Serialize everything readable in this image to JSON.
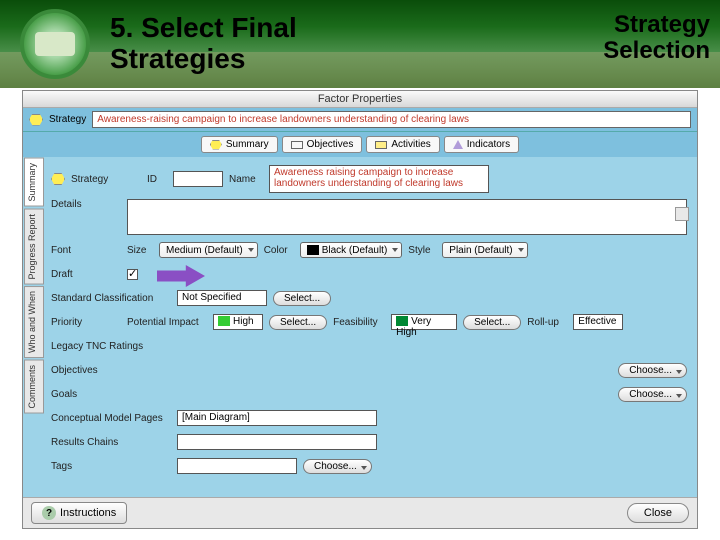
{
  "header": {
    "title_left": "5. Select Final\nStrategies",
    "title_right": "Strategy\nSelection"
  },
  "window": {
    "title": "Factor Properties",
    "strategy_label": "Strategy",
    "strategy_value": "Awareness-raising campaign to increase landowners understanding of clearing laws",
    "tabs": [
      "Summary",
      "Objectives",
      "Activities",
      "Indicators"
    ],
    "side_tabs": [
      "Summary",
      "Progress Report",
      "Who and When",
      "Comments"
    ]
  },
  "form": {
    "strategy_label": "Strategy",
    "id_label": "ID",
    "id_value": "",
    "name_label": "Name",
    "name_value": "Awareness raising campaign to increase landowners understanding of clearing laws",
    "details_label": "Details",
    "font_label": "Font",
    "size_label": "Size",
    "size_value": "Medium (Default)",
    "color_label": "Color",
    "color_value": "Black (Default)",
    "style_label": "Style",
    "style_value": "Plain (Default)",
    "draft_label": "Draft",
    "std_class_label": "Standard Classification",
    "std_class_value": "Not Specified",
    "select_btn": "Select...",
    "priority_label": "Priority",
    "potential_impact_label": "Potential Impact",
    "potential_impact_value": "High",
    "feasibility_label": "Feasibility",
    "feasibility_value": "Very High",
    "rollup_label": "Roll-up",
    "rollup_value": "Effective",
    "legacy_label": "Legacy TNC Ratings",
    "objectives_label": "Objectives",
    "goals_label": "Goals",
    "choose_btn": "Choose...",
    "cmp_label": "Conceptual Model Pages",
    "cmp_value": "[Main Diagram]",
    "results_label": "Results Chains",
    "tags_label": "Tags"
  },
  "footer": {
    "instructions": "Instructions",
    "close": "Close"
  }
}
